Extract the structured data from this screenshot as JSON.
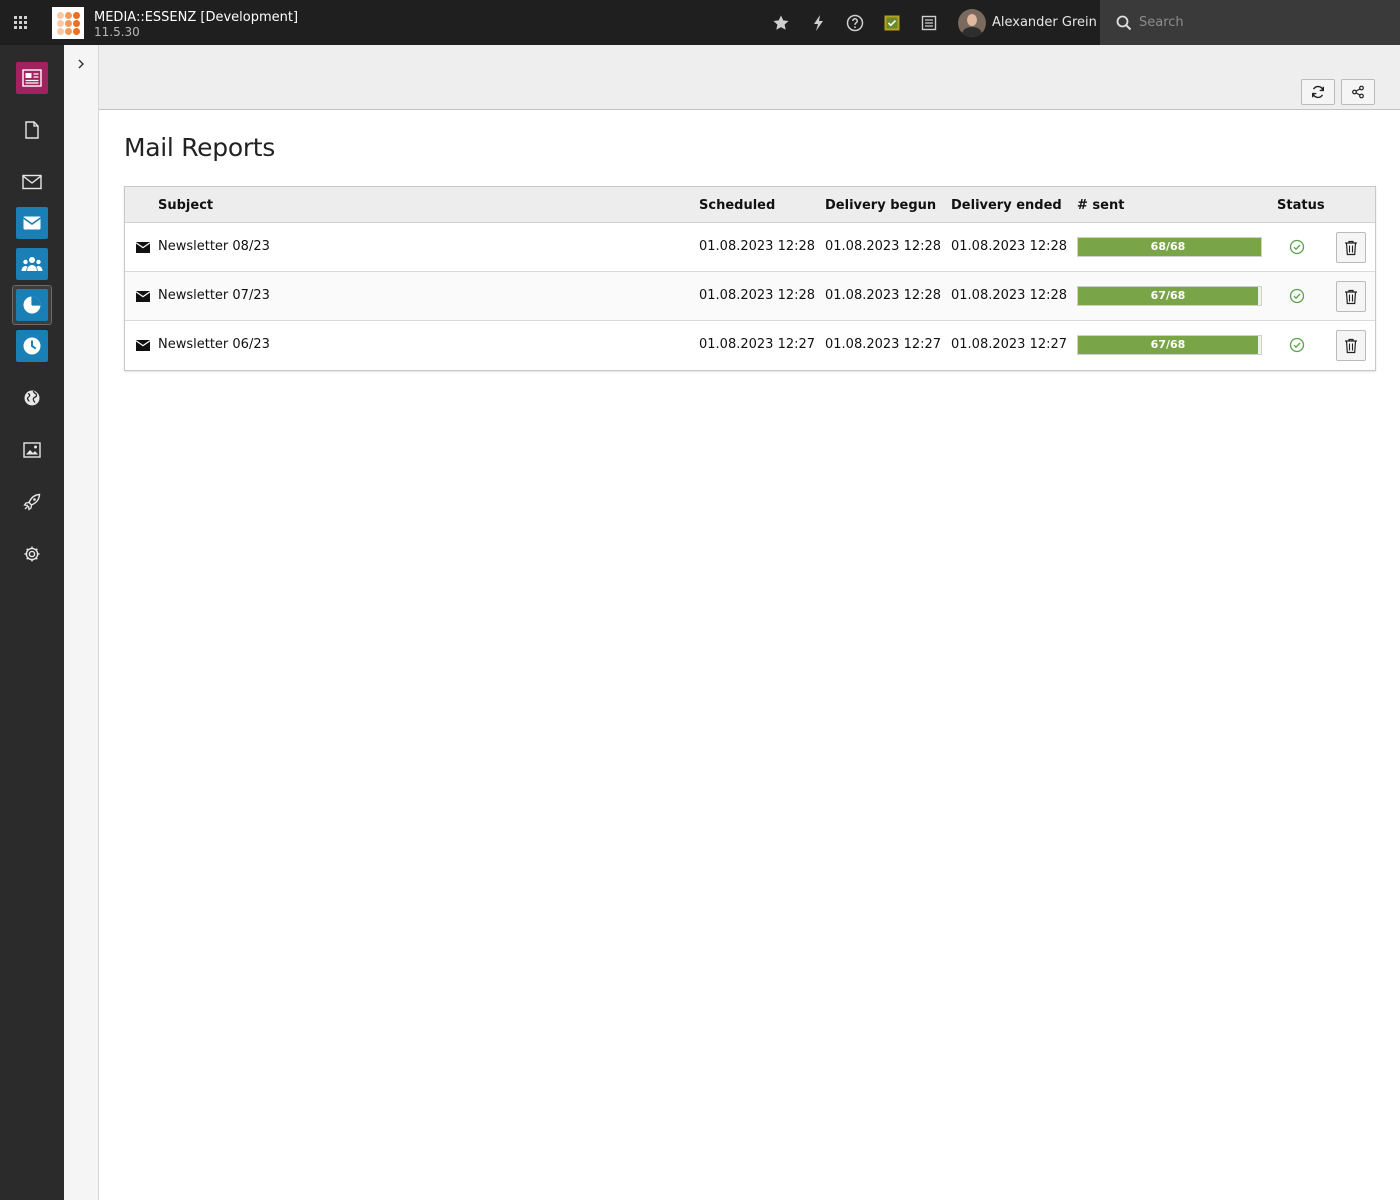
{
  "topbar": {
    "site_name": "MEDIA::ESSENZ [Development]",
    "site_version": "11.5.30",
    "user_name": "Alexander Grein",
    "search_placeholder": "Search",
    "icons": [
      "modulemenu-grid-icon",
      "star-icon",
      "bolt-icon",
      "help-icon",
      "scheduler-icon",
      "list-icon",
      "avatar"
    ]
  },
  "modules": [
    "web-layout-icon",
    "page-icon",
    "mail-icon",
    "mail-wizard-icon",
    "recipients-icon",
    "mail-reports-icon",
    "queue-clock-icon",
    "globe-icon",
    "image-icon",
    "rocket-icon",
    "gear-icon"
  ],
  "page": {
    "title": "Mail Reports"
  },
  "table": {
    "headers": {
      "subject": "Subject",
      "scheduled": "Scheduled",
      "delivery_begun": "Delivery begun",
      "delivery_ended": "Delivery ended",
      "sent": "# sent",
      "status": "Status"
    },
    "rows": [
      {
        "subject": "Newsletter 08/23",
        "scheduled": "01.08.2023 12:28",
        "delivery_begun": "01.08.2023 12:28",
        "delivery_ended": "01.08.2023 12:28",
        "sent": "68/68",
        "progress": 1.0,
        "status": "check-circle-icon"
      },
      {
        "subject": "Newsletter 07/23",
        "scheduled": "01.08.2023 12:28",
        "delivery_begun": "01.08.2023 12:28",
        "delivery_ended": "01.08.2023 12:28",
        "sent": "67/68",
        "progress": 0.985,
        "status": "check-circle-icon"
      },
      {
        "subject": "Newsletter 06/23",
        "scheduled": "01.08.2023 12:27",
        "delivery_begun": "01.08.2023 12:27",
        "delivery_ended": "01.08.2023 12:27",
        "sent": "67/68",
        "progress": 0.985,
        "status": "check-circle-icon"
      }
    ]
  },
  "colors": {
    "topbar_bg": "#1f1f1f",
    "modmenu_bg": "#2b2b2b",
    "module_blue": "#1a7fb5",
    "module_magenta": "#a2215f",
    "progress_green": "#79a548",
    "status_green": "#5aa24a"
  }
}
